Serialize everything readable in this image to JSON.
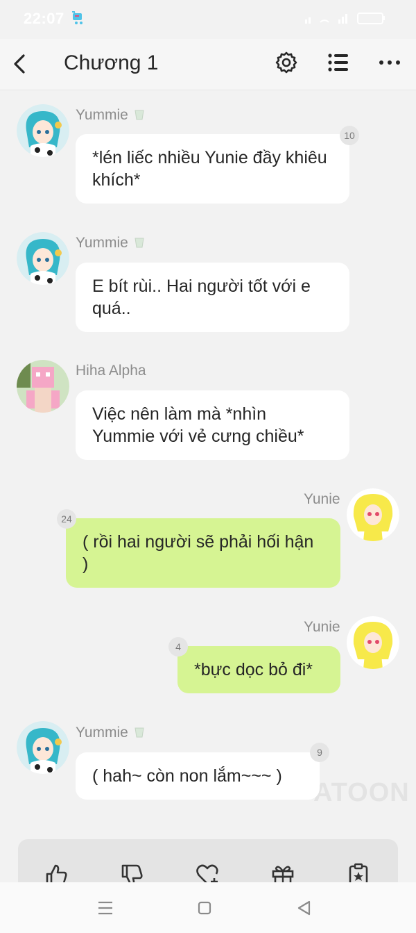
{
  "status_bar": {
    "time": "22:07"
  },
  "header": {
    "title": "Chương 1"
  },
  "messages": [
    {
      "sender": "Yummie",
      "text": "*lén liếc nhiều Yunie đầy khiêu khích*",
      "badge": "10"
    },
    {
      "sender": "Yummie",
      "text": "E bít rùi.. Hai người tốt với e quá.."
    },
    {
      "sender": "Hiha Alpha",
      "text": "Việc nên làm mà *nhìn Yummie với vẻ cưng chiều*"
    },
    {
      "sender": "Yunie",
      "text": "( rồi hai người sẽ phải hối hận )",
      "badge": "24"
    },
    {
      "sender": "Yunie",
      "text": "*bực dọc bỏ đi*",
      "badge": "4"
    },
    {
      "sender": "Yummie",
      "text": "( hah~ còn non lắm~~~ )",
      "badge": "9"
    }
  ],
  "watermark": "ATOON",
  "colors": {
    "right_bubble": "#d6f493",
    "left_bubble": "#ffffff",
    "background": "#f2f2f2"
  },
  "action_bar_icons": [
    "thumbs-up-icon",
    "thumbs-down-icon",
    "heart-plus-icon",
    "gift-icon",
    "clipboard-star-icon"
  ],
  "nav_icons": [
    "menu-icon",
    "home-icon",
    "back-icon"
  ]
}
